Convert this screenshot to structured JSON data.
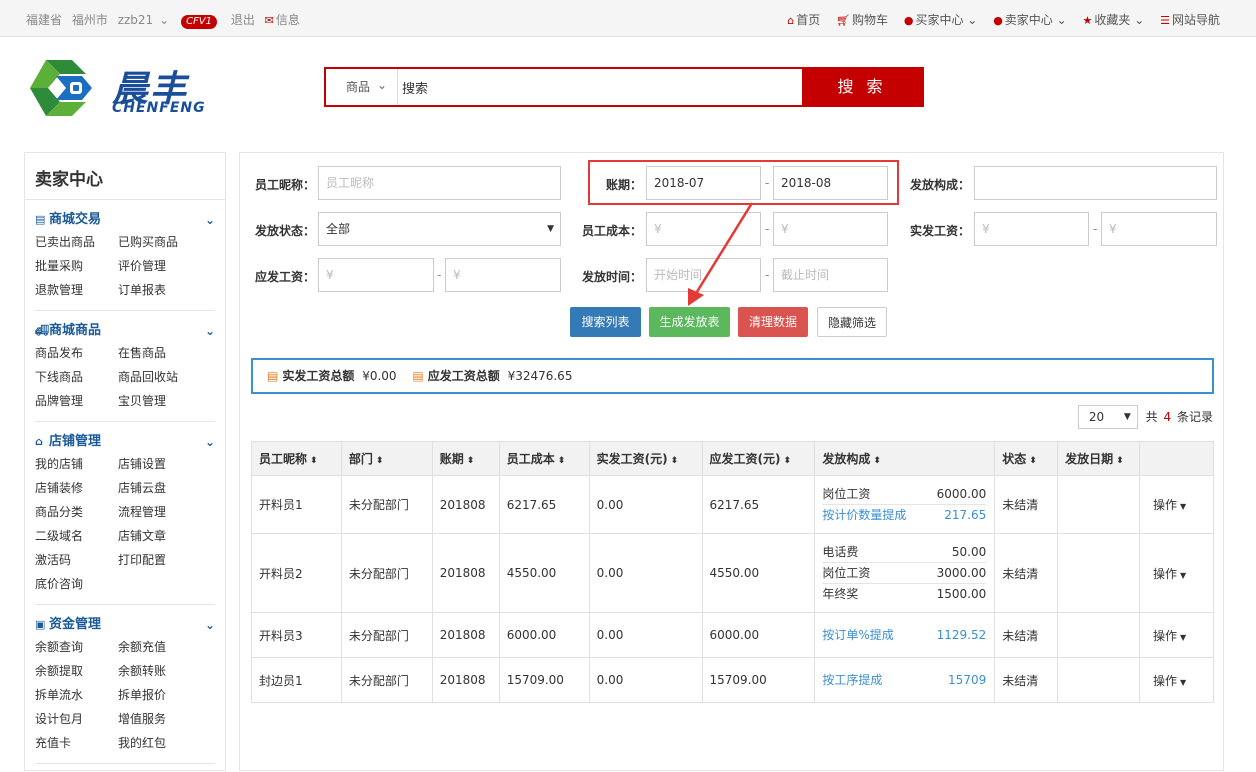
{
  "topbar": {
    "province": "福建省",
    "city": "福州市",
    "user": "zzb21",
    "badge": "CFV1",
    "logout": "退出",
    "message": "信息",
    "nav": [
      "首页",
      "购物车",
      "买家中心",
      "卖家中心",
      "收藏夹",
      "网站导航"
    ]
  },
  "logo": {
    "cn": "晨丰",
    "en": "CHENFENG"
  },
  "search": {
    "category": "商品",
    "placeholder": "搜索",
    "button": "搜 索"
  },
  "sidebar": {
    "title": "卖家中心",
    "groups": [
      {
        "title": "商城交易",
        "icon": "list-icon",
        "items": [
          "已卖出商品",
          "已购买商品",
          "批量采购",
          "评价管理",
          "退款管理",
          "订单报表"
        ]
      },
      {
        "title": "商城商品",
        "icon": "truck-icon",
        "items": [
          "商品发布",
          "在售商品",
          "下线商品",
          "商品回收站",
          "品牌管理",
          "宝贝管理"
        ]
      },
      {
        "title": "店铺管理",
        "icon": "home-icon",
        "items": [
          "我的店铺",
          "店铺设置",
          "店铺装修",
          "店铺云盘",
          "商品分类",
          "流程管理",
          "二级域名",
          "店铺文章",
          "激活码",
          "打印配置",
          "底价咨询"
        ]
      },
      {
        "title": "资金管理",
        "icon": "money-icon",
        "items": [
          "余额查询",
          "余额充值",
          "余额提取",
          "余额转账",
          "拆单流水",
          "拆单报价",
          "设计包月",
          "增值服务",
          "充值卡",
          "我的红包"
        ]
      }
    ]
  },
  "filters": {
    "nickname_label": "员工昵称：",
    "nickname_placeholder": "员工昵称",
    "period_label": "账期：",
    "period_from": "2018-07",
    "period_to": "2018-08",
    "composition_label": "发放构成：",
    "status_label": "发放状态：",
    "status_value": "全部",
    "cost_label": "员工成本：",
    "actual_label": "实发工资：",
    "payable_label": "应发工资：",
    "time_label": "发放时间：",
    "time_start": "开始时间",
    "time_end": "截止时间",
    "yen": "¥",
    "dash": "-"
  },
  "buttons": {
    "search": "搜索列表",
    "generate": "生成发放表",
    "clear": "清理数据",
    "hide": "隐藏筛选"
  },
  "buttonColors": {
    "search": "#337ab7",
    "generate": "#5cb85c",
    "clear": "#d9534f"
  },
  "summary": {
    "actual_label": "实发工资总额",
    "actual_value": "¥0.00",
    "payable_label": "应发工资总额",
    "payable_value": "¥32476.65"
  },
  "pager": {
    "page_size": "20",
    "total_prefix": "共",
    "total": "4",
    "total_suffix": "条记录"
  },
  "table": {
    "headers": [
      "员工昵称",
      "部门",
      "账期",
      "员工成本",
      "实发工资(元)",
      "应发工资(元)",
      "发放构成",
      "状态",
      "发放日期",
      ""
    ],
    "rows": [
      {
        "name": "开料员1",
        "dept": "未分配部门",
        "period": "201808",
        "cost": "6217.65",
        "actual": "0.00",
        "payable": "6217.65",
        "composition": [
          {
            "k": "岗位工资",
            "v": "6000.00",
            "link": false
          },
          {
            "k": "按计价数量提成",
            "v": "217.65",
            "link": true
          }
        ],
        "status": "未结清",
        "date": "",
        "op": "操作"
      },
      {
        "name": "开料员2",
        "dept": "未分配部门",
        "period": "201808",
        "cost": "4550.00",
        "actual": "0.00",
        "payable": "4550.00",
        "composition": [
          {
            "k": "电话费",
            "v": "50.00",
            "link": false
          },
          {
            "k": "岗位工资",
            "v": "3000.00",
            "link": false
          },
          {
            "k": "年终奖",
            "v": "1500.00",
            "link": false
          }
        ],
        "status": "未结清",
        "date": "",
        "op": "操作"
      },
      {
        "name": "开料员3",
        "dept": "未分配部门",
        "period": "201808",
        "cost": "6000.00",
        "actual": "0.00",
        "payable": "6000.00",
        "composition": [
          {
            "k": "按订单%提成",
            "v": "1129.52",
            "link": true
          }
        ],
        "status": "未结清",
        "date": "",
        "op": "操作"
      },
      {
        "name": "封边员1",
        "dept": "未分配部门",
        "period": "201808",
        "cost": "15709.00",
        "actual": "0.00",
        "payable": "15709.00",
        "composition": [
          {
            "k": "按工序提成",
            "v": "15709",
            "link": true
          }
        ],
        "status": "未结清",
        "date": "",
        "op": "操作"
      }
    ]
  }
}
